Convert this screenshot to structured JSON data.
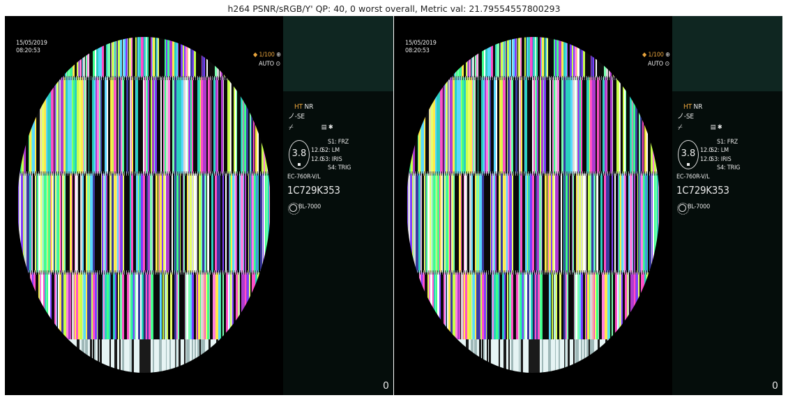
{
  "figure": {
    "title": "h264 PSNR/sRGB/Y' QP: 40, 0 worst overall, Metric val: 21.79554557800293"
  },
  "panels": [
    {
      "id": "left",
      "overlay": {
        "date": "15/05/2019",
        "time": "08:20:53",
        "shutter": "◆ 1/100",
        "auto": "AUTO"
      },
      "side": {
        "ht": "HT",
        "nr": "NR",
        "mode": "ノ-SE",
        "aperture_value": "3.8",
        "val1": "12.0",
        "val2": "12.0",
        "s1": "S1: FRZ",
        "s2": "S2: LM",
        "s3": "S3: IRIS",
        "s4": "S4: TRIG",
        "model": "EC-760R-V/L",
        "serial": "1C729K353",
        "light": "BL-7000",
        "counter": "0"
      }
    },
    {
      "id": "right",
      "overlay": {
        "date": "15/05/2019",
        "time": "08:20:53",
        "shutter": "◆ 1/100",
        "auto": "AUTO"
      },
      "side": {
        "ht": "HT",
        "nr": "NR",
        "mode": "ノ-SE",
        "aperture_value": "3.8",
        "val1": "12.0",
        "val2": "12.0",
        "s1": "S1: FRZ",
        "s2": "S2: LM",
        "s3": "S3: IRIS",
        "s4": "S4: TRIG",
        "model": "EC-760R-V/L",
        "serial": "1C729K353",
        "light": "BL-7000",
        "counter": "0"
      }
    }
  ],
  "colors": {
    "stripe_palette": [
      "#ff4fc8",
      "#7d3cff",
      "#c8ff4a",
      "#3dff8a",
      "#ffffff",
      "#5ad8ff",
      "#b13ad0",
      "#e8ff6a",
      "#2ad0c0",
      "#ff80e0",
      "#ffe94a",
      "#3a3aa0",
      "#7affb0",
      "#d9d9d9"
    ],
    "side_top": "#0f2621",
    "side_bottom": "#050d0b",
    "accent_orange": "#e7a33c"
  }
}
